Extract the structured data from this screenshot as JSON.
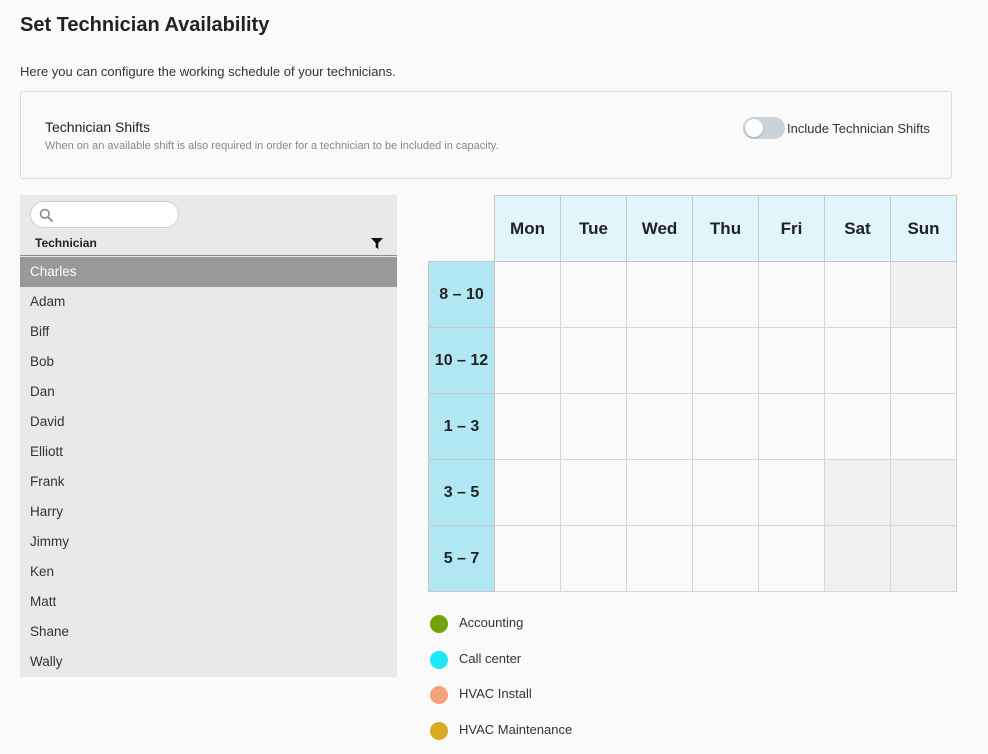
{
  "page": {
    "title": "Set Technician Availability",
    "intro": "Here you can configure the working schedule of your technicians."
  },
  "shifts": {
    "title": "Technician Shifts",
    "description": "When on an available shift is also required in order for a technician to be included in capacity.",
    "toggle_label": "Include Technician Shifts",
    "toggle_on": false
  },
  "technicians": {
    "search_placeholder": "",
    "column_header": "Technician",
    "selected": "Charles",
    "list": [
      "Charles",
      "Adam",
      "Biff",
      "Bob",
      "Dan",
      "David",
      "Elliott",
      "Frank",
      "Harry",
      "Jimmy",
      "Ken",
      "Matt",
      "Shane",
      "Wally"
    ]
  },
  "schedule": {
    "days": [
      "Mon",
      "Tue",
      "Wed",
      "Thu",
      "Fri",
      "Sat",
      "Sun"
    ],
    "slots": [
      "8 – 10",
      "10 – 12",
      "1 – 3",
      "3 – 5",
      "5 – 7"
    ],
    "unavailable": [
      [
        0,
        6
      ],
      [
        3,
        5
      ],
      [
        3,
        6
      ],
      [
        4,
        5
      ],
      [
        4,
        6
      ]
    ]
  },
  "legend": [
    {
      "label": "Accounting",
      "color": "#73a20f"
    },
    {
      "label": "Call center",
      "color": "#1ee8f8"
    },
    {
      "label": "HVAC Install",
      "color": "#f7a17b"
    },
    {
      "label": "HVAC Maintenance",
      "color": "#d9a925"
    }
  ]
}
